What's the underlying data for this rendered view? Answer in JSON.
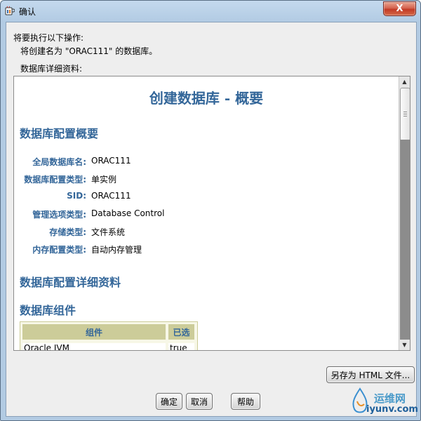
{
  "window": {
    "title": "确认",
    "close_glyph": "X"
  },
  "message": {
    "line1": "将要执行以下操作:",
    "line2": "将创建名为 \"ORAC111\" 的数据库。",
    "details_label": "数据库详细资料:"
  },
  "summary": {
    "title": "创建数据库 - 概要",
    "config_summary_heading": "数据库配置概要",
    "fields": [
      {
        "label": "全局数据库名:",
        "value": "ORAC111"
      },
      {
        "label": "数据库配置类型:",
        "value": "单实例"
      },
      {
        "label": "SID:",
        "value": "ORAC111"
      },
      {
        "label": "管理选项类型:",
        "value": "Database Control"
      },
      {
        "label": "存储类型:",
        "value": "文件系统"
      },
      {
        "label": "内存配置类型:",
        "value": "自动内存管理"
      }
    ],
    "config_details_heading": "数据库配置详细资料",
    "components_heading": "数据库组件",
    "components_table": {
      "headers": [
        "组件",
        "已选"
      ],
      "rows": [
        [
          "Oracle JVM",
          "true"
        ]
      ]
    }
  },
  "buttons": {
    "save_html": "另存为 HTML 文件...",
    "ok": "确定",
    "cancel": "取消",
    "help": "帮助"
  },
  "watermark": {
    "name": "运维网",
    "url": "iyunv.com"
  },
  "icons": {
    "window_icon": "java-cup-icon",
    "scroll_up": "up-arrow-icon",
    "scroll_down": "down-arrow-icon"
  },
  "colors": {
    "heading_blue": "#336699",
    "table_header": "#cccc99",
    "title_bar": "#b2cbe3",
    "close_red": "#c23a25"
  }
}
